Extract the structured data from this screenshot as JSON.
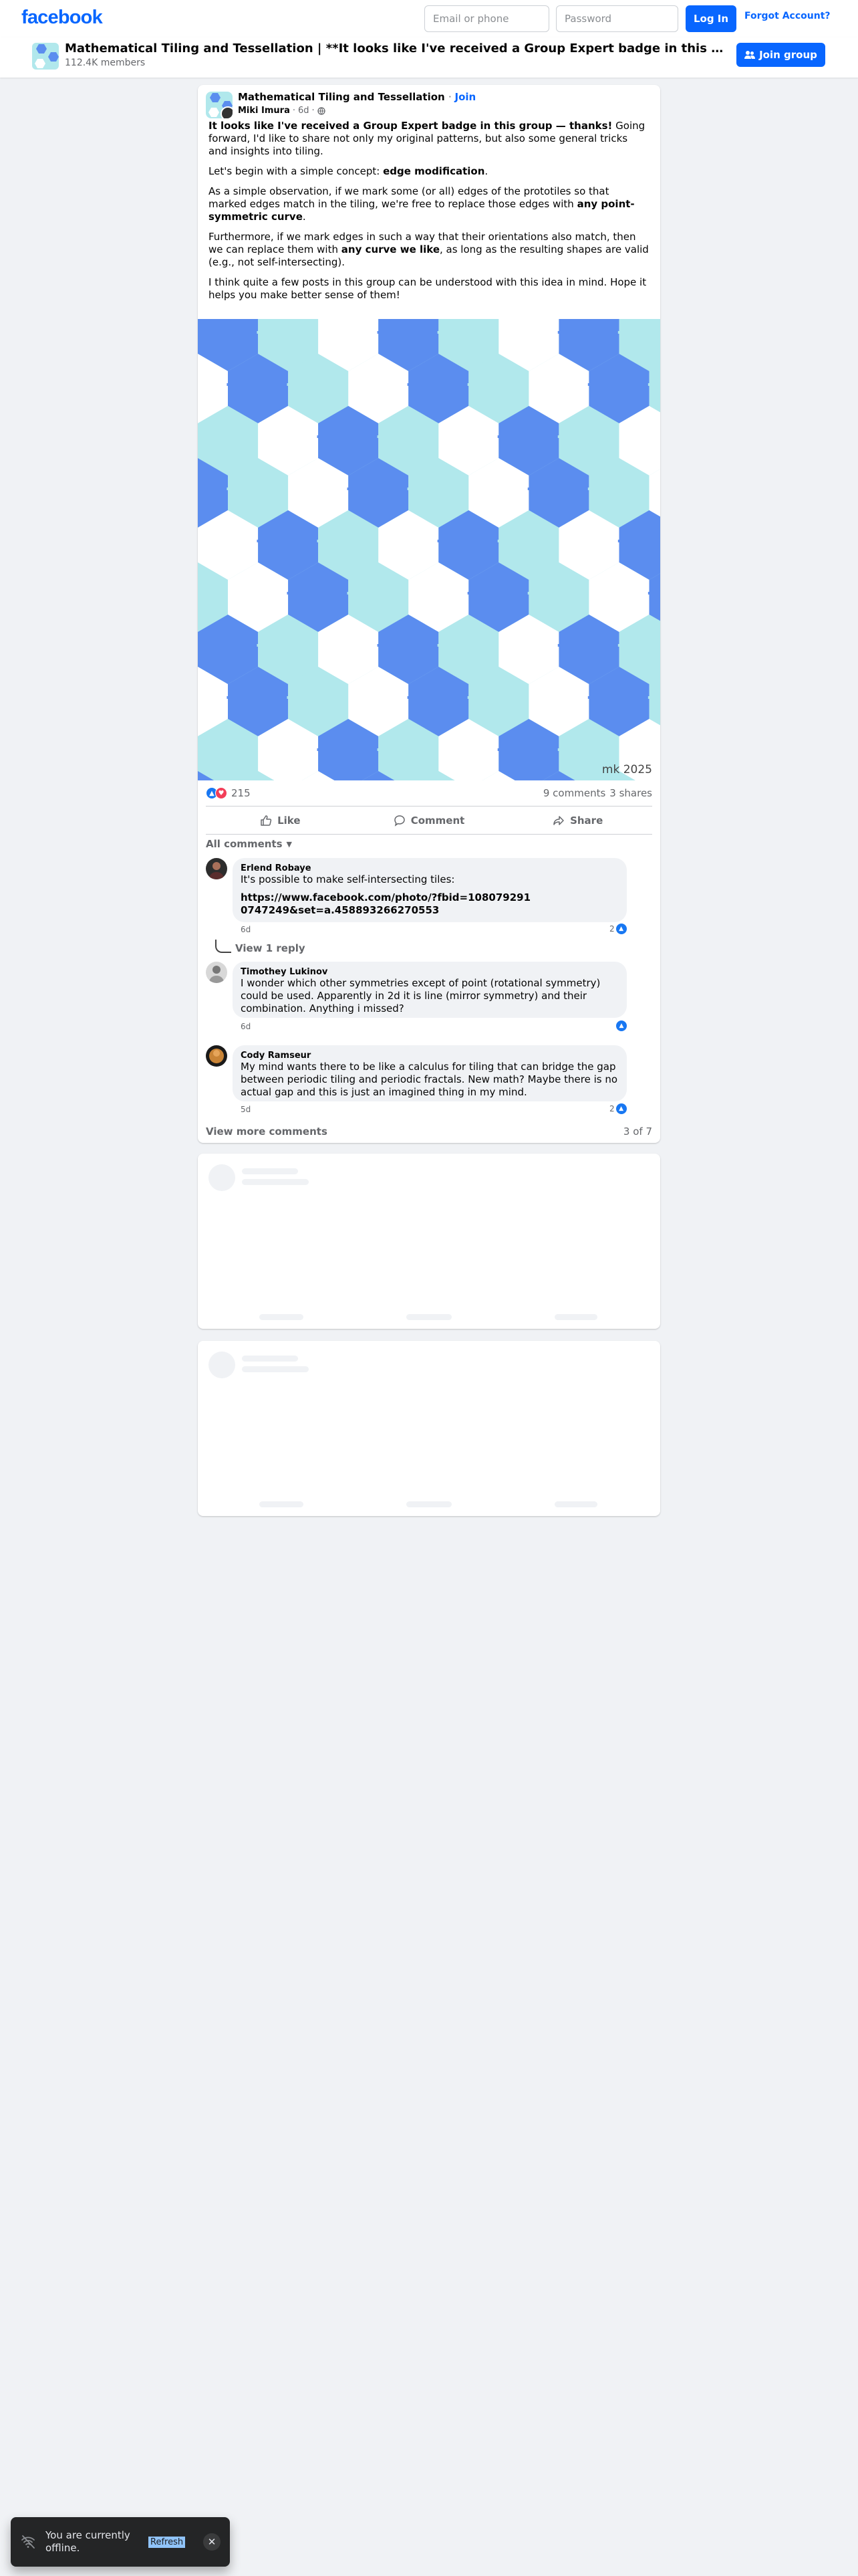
{
  "header": {
    "logo": "facebook",
    "email_placeholder": "Email or phone",
    "password_placeholder": "Password",
    "login_label": "Log In",
    "forgot_label": "Forgot Account?"
  },
  "group_bar": {
    "title": "Mathematical Tiling and Tessellation | **It looks like I've received a Group Expert badge in this group — thanks!** Going forward, I'd like to share not only my original patterns",
    "members": "112.4K members",
    "join_label": "Join group"
  },
  "post": {
    "group_name": "Mathematical Tiling and Tessellation",
    "join_link": "Join",
    "author": "Miki Imura",
    "time": "6d",
    "paragraphs": [
      {
        "bold_lead": "It looks like I've received a Group Expert badge in this group — thanks!",
        "text": " Going forward, I'd like to share not only my original patterns, but also some general tricks and insights into tiling."
      },
      {
        "text_lead": "Let's begin with a simple concept: ",
        "bold": "edge modification",
        "text_end": "."
      },
      {
        "text_lead": "As a simple observation, if we mark some (or all) edges of the prototiles so that marked edges match in the tiling, we're free to replace those edges with ",
        "bold": "any point-symmetric curve",
        "text_end": "."
      },
      {
        "text_lead": "Furthermore, if we mark edges in such a way that their orientations also match, then we can replace them with ",
        "bold": "any curve we like",
        "text_end": ", as long as the resulting shapes are valid (e.g., not self-intersecting)."
      },
      {
        "text_lead": "I think quite a few posts in this group can be understood with this idea in mind. Hope it helps you make better sense of them!",
        "bold": "",
        "text_end": ""
      }
    ],
    "image_watermark": "mk 2025",
    "reaction_count": "215",
    "comment_count": "9 comments",
    "share_count": "3 shares",
    "actions": {
      "like": "Like",
      "comment": "Comment",
      "share": "Share"
    },
    "all_comments_label": "All comments",
    "comments": [
      {
        "name": "Erlend Robaye",
        "text": "It's possible to make self-intersecting tiles:",
        "link": "https://www.facebook.com/photo/?fbid=1080792910747249&set=a.458893266270553",
        "time": "6d",
        "likes": "2"
      },
      {
        "name": "Timothey Lukinov",
        "text": "I wonder which other symmetries except of point (rotational symmetry) could be used. Apparently in 2d it is line (mirror symmetry) and their combination. Anything i missed?",
        "time": "6d",
        "likes": ""
      },
      {
        "name": "Cody Ramseur",
        "text": "My mind wants there to be like a calculus for tiling that can bridge the gap between periodic tiling and periodic fractals. New math? Maybe there is no actual gap and this is just an imagined thing in my mind.",
        "time": "5d",
        "likes": "2"
      }
    ],
    "view_reply_label": "View 1 reply",
    "view_more_label": "View more comments",
    "page_count": "3 of 7"
  },
  "toast": {
    "message": "You are currently offline.",
    "refresh_label": "Refresh"
  },
  "colors": {
    "brand": "#0866ff",
    "tile_dark": "#5b8def",
    "tile_light": "#b1e8ec",
    "tile_white": "#ffffff"
  }
}
